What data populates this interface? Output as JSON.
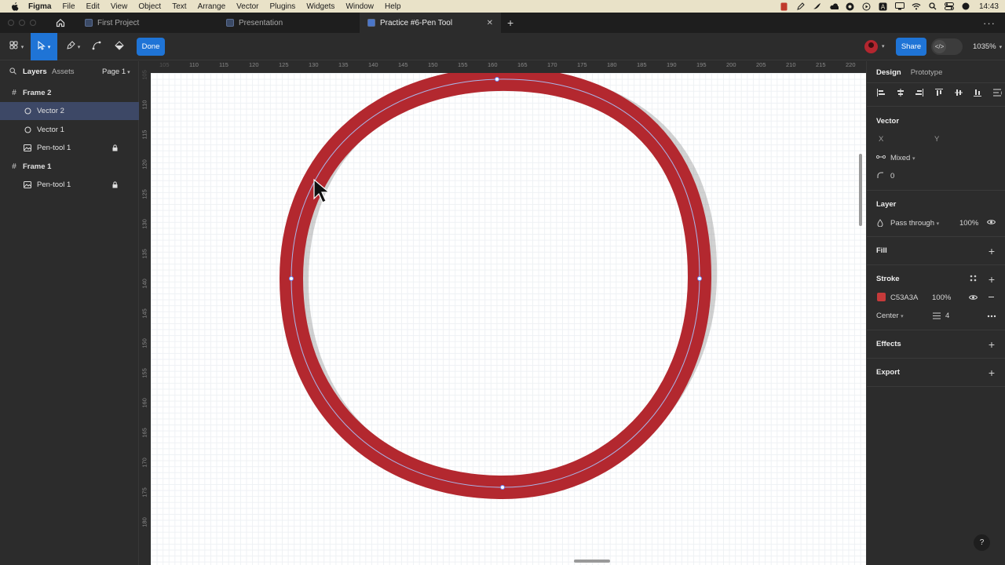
{
  "menubar": {
    "app": "Figma",
    "items": [
      "File",
      "Edit",
      "View",
      "Object",
      "Text",
      "Arrange",
      "Vector",
      "Plugins",
      "Widgets",
      "Window",
      "Help"
    ],
    "time": "14:43"
  },
  "tabs": [
    {
      "label": "First Project"
    },
    {
      "label": "Presentation"
    },
    {
      "label": "Practice #6-Pen Tool"
    }
  ],
  "toolbar": {
    "done_label": "Done",
    "share_label": "Share",
    "zoom": "1035%"
  },
  "left_panel": {
    "tab_layers": "Layers",
    "tab_assets": "Assets",
    "page": "Page 1",
    "layers": [
      {
        "label": "Frame 2",
        "kind": "frame"
      },
      {
        "label": "Vector 2",
        "kind": "vector",
        "selected": true
      },
      {
        "label": "Vector 1",
        "kind": "vector"
      },
      {
        "label": "Pen-tool 1",
        "kind": "image",
        "locked": true
      },
      {
        "label": "Frame 1",
        "kind": "frame"
      },
      {
        "label": "Pen-tool 1",
        "kind": "image",
        "locked": true
      }
    ]
  },
  "rulers": {
    "top": [
      "105",
      "110",
      "115",
      "120",
      "125",
      "130",
      "135",
      "140",
      "145",
      "150",
      "155",
      "160",
      "165",
      "170",
      "175",
      "180",
      "185",
      "190",
      "195",
      "200",
      "205",
      "210",
      "215",
      "220"
    ],
    "left": [
      "105",
      "110",
      "115",
      "120",
      "125",
      "130",
      "135",
      "140",
      "145",
      "150",
      "155",
      "160",
      "165",
      "170",
      "175",
      "180"
    ]
  },
  "canvas": {
    "stroke_color": "#C53A3A"
  },
  "right_panel": {
    "tab_design": "Design",
    "tab_prototype": "Prototype",
    "vector": {
      "title": "Vector",
      "x_label": "X",
      "y_label": "Y",
      "mixed": "Mixed",
      "corner": "0"
    },
    "layer": {
      "title": "Layer",
      "blend": "Pass through",
      "opacity": "100%"
    },
    "fill": {
      "title": "Fill"
    },
    "stroke": {
      "title": "Stroke",
      "hex": "C53A3A",
      "opacity": "100%",
      "position": "Center",
      "weight": "4"
    },
    "effects": {
      "title": "Effects"
    },
    "export": {
      "title": "Export"
    }
  },
  "help": "?"
}
